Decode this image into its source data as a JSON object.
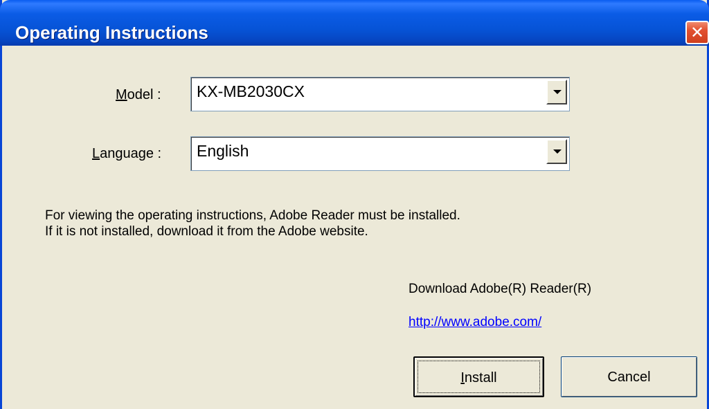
{
  "window": {
    "title": "Operating Instructions",
    "close_glyph": "✕"
  },
  "form": {
    "model_label": "Model :",
    "model_value": "KX-MB2030CX",
    "language_label": "Language :",
    "language_value": "English"
  },
  "info": {
    "line1": "For viewing the operating instructions, Adobe Reader must be installed.",
    "line2": "If it is not installed, download it from the Adobe website."
  },
  "download": {
    "label": "Download Adobe(R) Reader(R)",
    "link": "http://www.adobe.com/"
  },
  "buttons": {
    "install": "Install",
    "cancel": "Cancel"
  },
  "colors": {
    "titlebar": "#0653D6",
    "dialog_bg": "#ECE9D8",
    "close_button": "#E2502F",
    "link": "#0000FF"
  },
  "icons": {
    "close": "close-icon",
    "dropdown": "chevron-down-icon"
  }
}
